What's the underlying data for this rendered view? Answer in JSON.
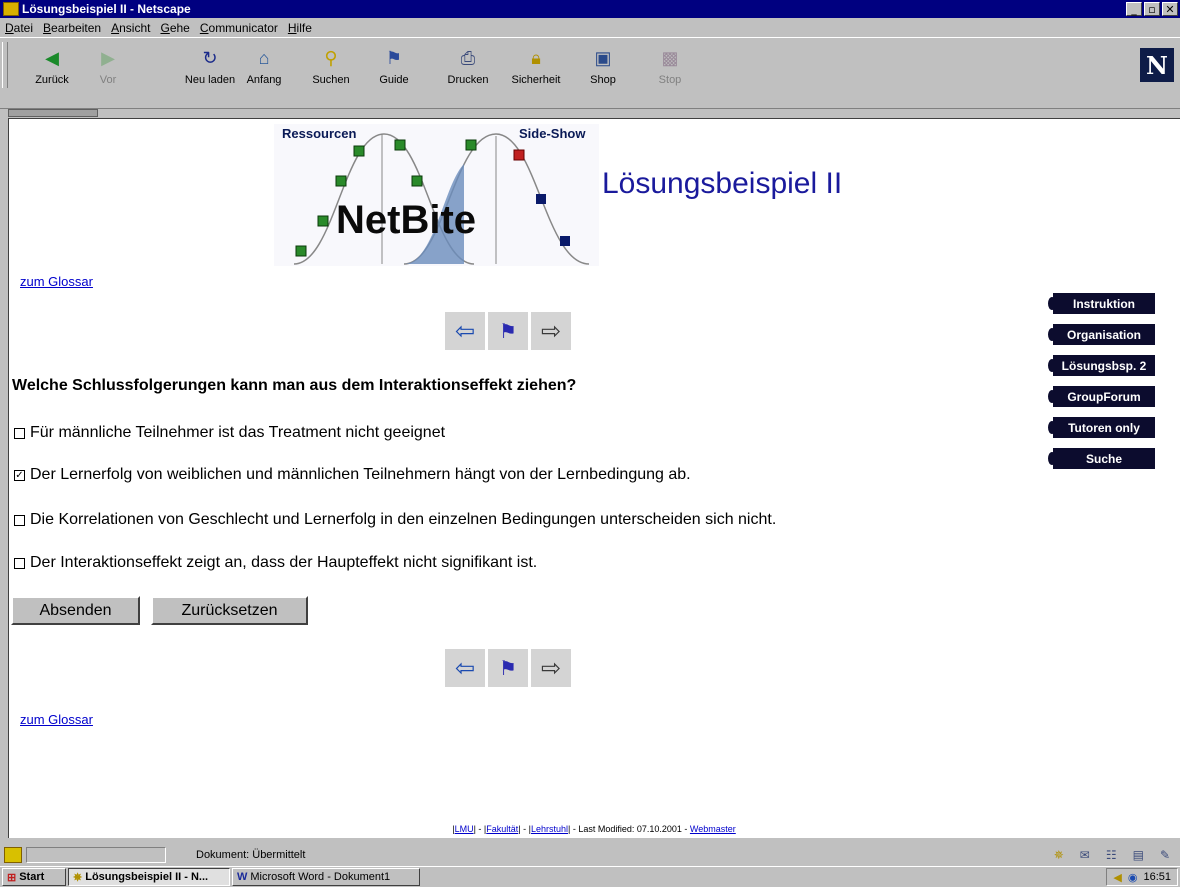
{
  "window": {
    "title": "Lösungsbeispiel II - Netscape"
  },
  "menu": [
    "Datei",
    "Bearbeiten",
    "Ansicht",
    "Gehe",
    "Communicator",
    "Hilfe"
  ],
  "toolbar": {
    "buttons": [
      {
        "label": "Zurück",
        "icon": "back-arrow-icon",
        "enabled": true
      },
      {
        "label": "Vor",
        "icon": "forward-arrow-icon",
        "enabled": false
      },
      {
        "label": "Neu laden",
        "icon": "reload-icon",
        "enabled": true
      },
      {
        "label": "Anfang",
        "icon": "home-icon",
        "enabled": true
      },
      {
        "label": "Suchen",
        "icon": "search-icon",
        "enabled": true
      },
      {
        "label": "Guide",
        "icon": "guide-icon",
        "enabled": true
      },
      {
        "label": "Drucken",
        "icon": "print-icon",
        "enabled": true
      },
      {
        "label": "Sicherheit",
        "icon": "lock-icon",
        "enabled": true
      },
      {
        "label": "Shop",
        "icon": "shop-icon",
        "enabled": true
      },
      {
        "label": "Stop",
        "icon": "stop-icon",
        "enabled": false
      }
    ]
  },
  "page": {
    "logo": {
      "left_label": "Ressourcen",
      "right_label": "Side-Show",
      "wordmark": "NetBite"
    },
    "title": "Lösungsbeispiel II",
    "glossar_link": "zum Glossar",
    "question": "Welche Schlussfolgerungen kann man aus dem Interaktionseffekt ziehen?",
    "options": [
      {
        "text": "Für männliche Teilnehmer ist das Treatment nicht geeignet",
        "checked": false
      },
      {
        "text": "Der Lernerfolg von weiblichen und männlichen Teilnehmern hängt von der Lernbedingung ab.",
        "checked": true
      },
      {
        "text": "Die Korrelationen von Geschlecht und Lernerfolg in den einzelnen Bedingungen unterscheiden sich nicht.",
        "checked": false
      },
      {
        "text": "Der Interaktionseffekt zeigt an, dass der Haupteffekt nicht signifikant ist.",
        "checked": false
      }
    ],
    "submit_label": "Absenden",
    "reset_label": "Zurücksetzen",
    "sidenav": [
      "Instruktion",
      "Organisation",
      "Lösungsbsp. 2",
      "GroupForum",
      "Tutoren only",
      "Suche"
    ],
    "footer": {
      "lmu": "LMU",
      "fakultaet": "Fakultät",
      "lehrstuhl": "Lehrstuhl",
      "modified": "Last Modified: 07.10.2001",
      "webmaster": "Webmaster"
    }
  },
  "status": {
    "text": "Dokument: Übermittelt"
  },
  "taskbar": {
    "start": "Start",
    "tasks": [
      "Lösungsbeispiel II - N...",
      "Microsoft Word - Dokument1"
    ],
    "clock": "16:51"
  },
  "colors": {
    "titlebar": "#000080",
    "page_title": "#1a1a9c",
    "sidenav_bg": "#0c0c2e",
    "link": "#0000cc"
  }
}
